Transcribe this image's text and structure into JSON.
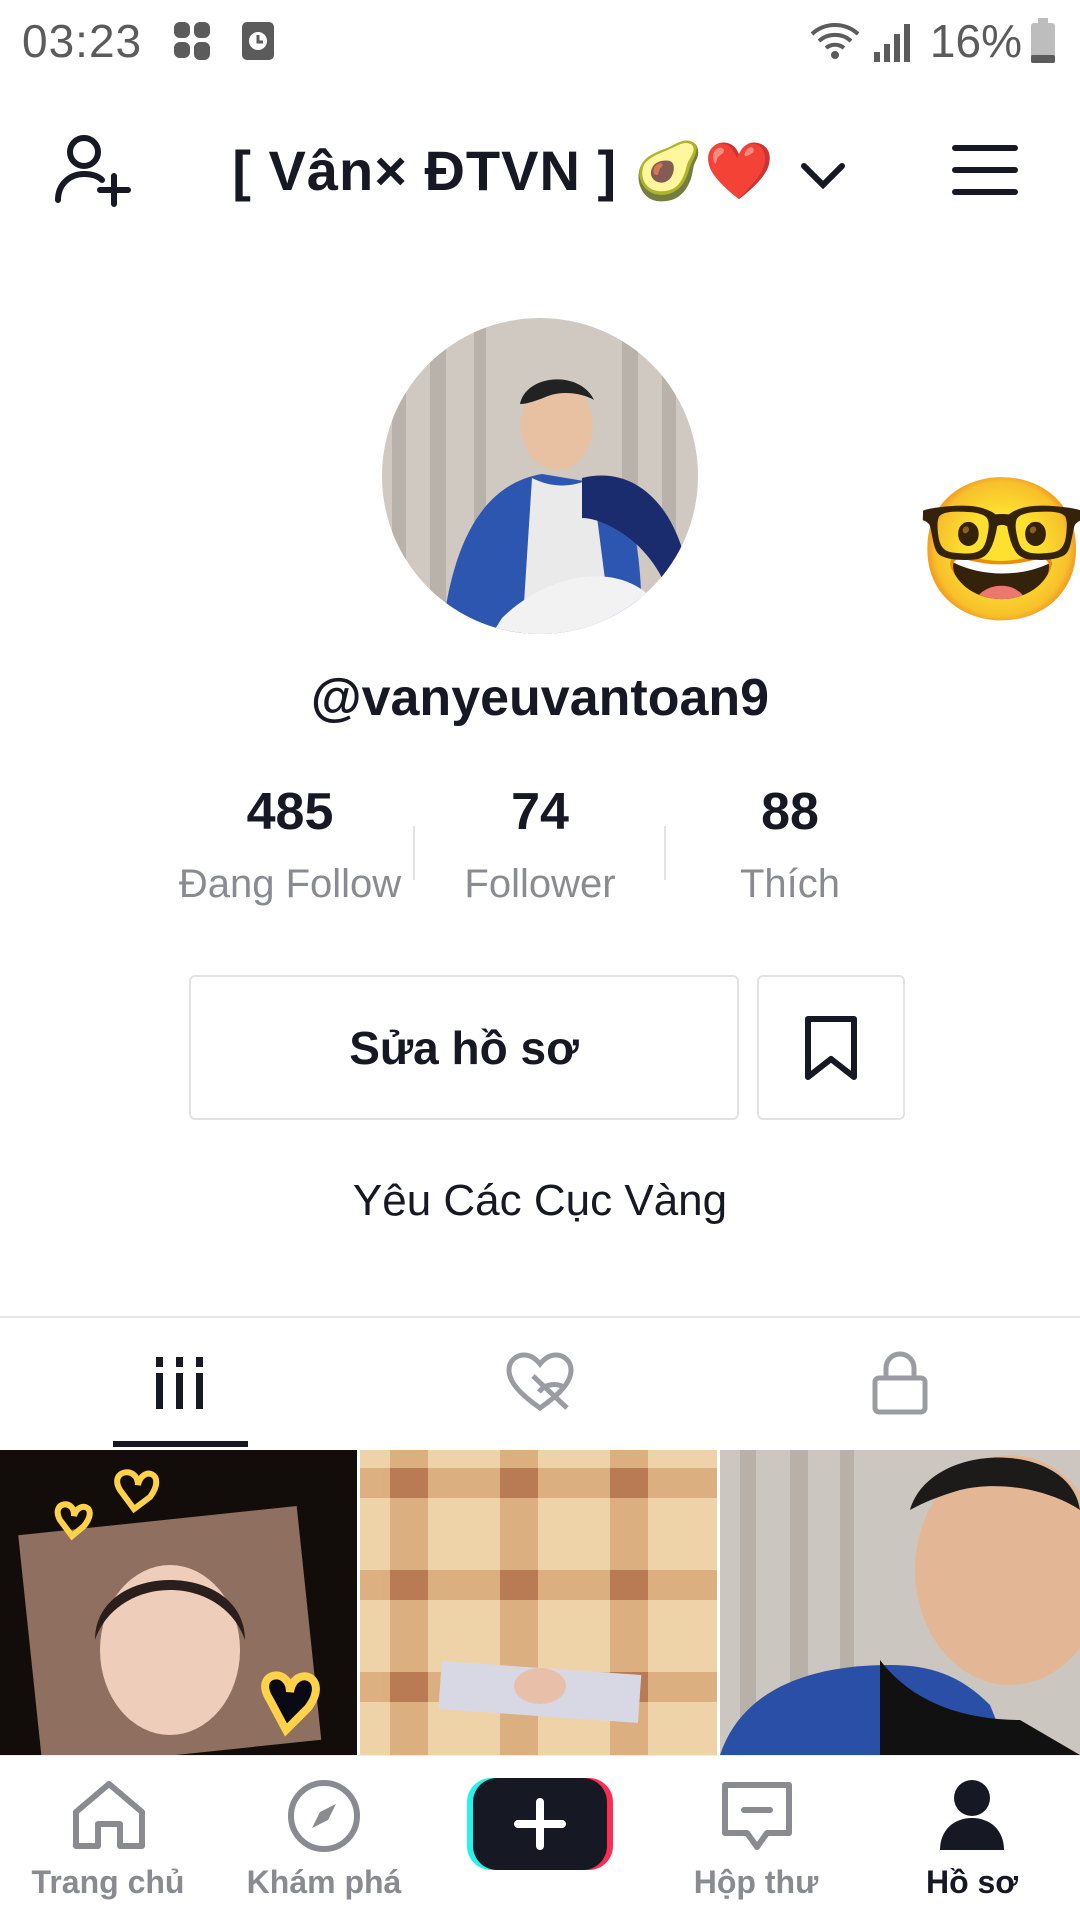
{
  "status_bar": {
    "time": "03:23",
    "battery_percent": "16%",
    "icons": [
      "app-icon",
      "clock-icon",
      "wifi-icon",
      "signal-icon",
      "battery-icon"
    ]
  },
  "header": {
    "title": "[ Vân× ĐTVN ] 🥑❤️",
    "icons": [
      "add-user-icon",
      "chevron-down-icon",
      "menu-icon"
    ]
  },
  "profile": {
    "handle": "@vanyeuvantoan9",
    "stats": [
      {
        "value": "485",
        "label": "Đang Follow"
      },
      {
        "value": "74",
        "label": "Follower"
      },
      {
        "value": "88",
        "label": "Thích"
      }
    ],
    "edit_button": "Sửa hồ sơ",
    "bio": "Yêu Các Cục Vàng",
    "sticker": "🤓"
  },
  "tabs": {
    "icons": [
      "grid-icon",
      "liked-hidden-icon",
      "lock-icon"
    ],
    "selected": 0
  },
  "bottom_nav": {
    "items": [
      {
        "label": "Trang chủ",
        "icon": "home-icon"
      },
      {
        "label": "Khám phá",
        "icon": "compass-icon"
      },
      {
        "label": "",
        "icon": "plus-icon"
      },
      {
        "label": "Hộp thư",
        "icon": "inbox-icon"
      },
      {
        "label": "Hồ sơ",
        "icon": "profile-icon"
      }
    ],
    "active_index": 4
  },
  "colors": {
    "text": "#161823",
    "secondary": "#8a8b91",
    "create_cyan": "#25f4ee",
    "create_red": "#fe2c55"
  }
}
